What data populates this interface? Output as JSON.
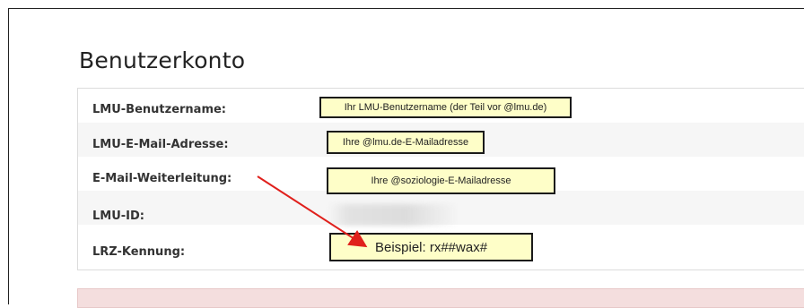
{
  "page": {
    "title": "Benutzerkonto"
  },
  "account": {
    "rows": [
      {
        "label": "LMU-Benutzername:"
      },
      {
        "label": "LMU-E-Mail-Adresse:"
      },
      {
        "label": "E-Mail-Weiterleitung:"
      },
      {
        "label": "LMU-ID:"
      },
      {
        "label": "LRZ-Kennung:"
      }
    ]
  },
  "annotations": {
    "username_hint": "Ihr LMU-Benutzername (der Teil vor @lmu.de)",
    "email_hint": "Ihre @lmu.de-E-Mailadresse",
    "forward_hint": "Ihre @soziologie-E-Mailadresse",
    "lrz_example": "Beispiel: rx##wax#"
  },
  "colors": {
    "note_background": "#fefec8",
    "arrow": "#e0201c",
    "alert_background": "#f4dede"
  }
}
